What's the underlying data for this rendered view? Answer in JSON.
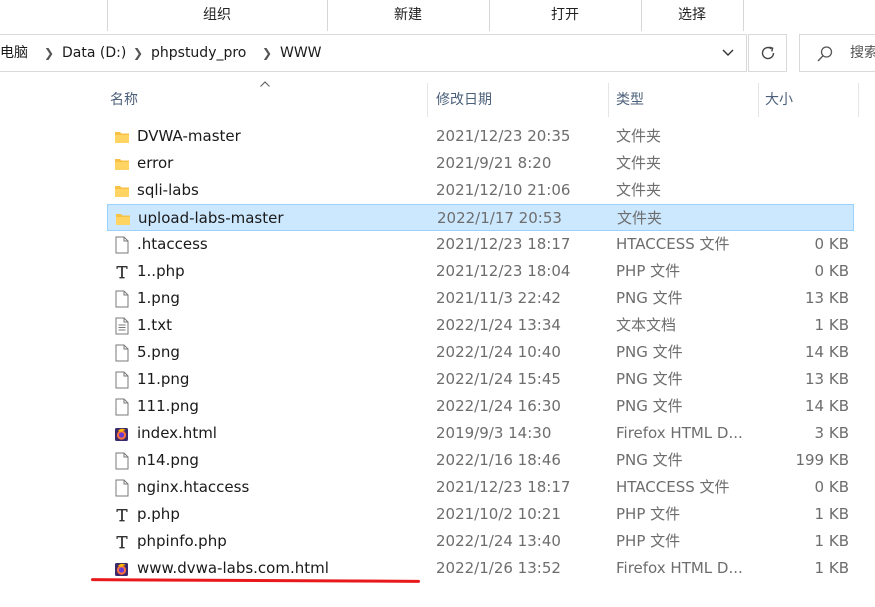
{
  "ribbon": {
    "groups": [
      "组织",
      "新建",
      "打开",
      "选择"
    ]
  },
  "address": {
    "crumbs": [
      "此电脑",
      "Data (D:)",
      "phpstudy_pro",
      "WWW"
    ],
    "search_placeholder": "搜索"
  },
  "columns": {
    "name": "名称",
    "date": "修改日期",
    "type": "类型",
    "size": "大小"
  },
  "files": [
    {
      "name": "DVWA-master",
      "date": "2021/12/23 20:35",
      "type": "文件夹",
      "size": "",
      "icon": "folder-icon"
    },
    {
      "name": "error",
      "date": "2021/9/21 8:20",
      "type": "文件夹",
      "size": "",
      "icon": "folder-icon"
    },
    {
      "name": "sqli-labs",
      "date": "2021/12/10 21:06",
      "type": "文件夹",
      "size": "",
      "icon": "folder-icon"
    },
    {
      "name": "upload-labs-master",
      "date": "2022/1/17 20:53",
      "type": "文件夹",
      "size": "",
      "icon": "folder-icon",
      "selected": true
    },
    {
      "name": ".htaccess",
      "date": "2021/12/23 18:17",
      "type": "HTACCESS 文件",
      "size": "0 KB",
      "icon": "file-icon"
    },
    {
      "name": "1..php",
      "date": "2021/12/23 18:04",
      "type": "PHP 文件",
      "size": "0 KB",
      "icon": "php-file-icon"
    },
    {
      "name": "1.png",
      "date": "2021/11/3 22:42",
      "type": "PNG 文件",
      "size": "13 KB",
      "icon": "file-icon"
    },
    {
      "name": "1.txt",
      "date": "2022/1/24 13:34",
      "type": "文本文档",
      "size": "1 KB",
      "icon": "text-file-icon"
    },
    {
      "name": "5.png",
      "date": "2022/1/24 10:40",
      "type": "PNG 文件",
      "size": "14 KB",
      "icon": "file-icon"
    },
    {
      "name": "11.png",
      "date": "2022/1/24 15:45",
      "type": "PNG 文件",
      "size": "13 KB",
      "icon": "file-icon"
    },
    {
      "name": "111.png",
      "date": "2022/1/24 16:30",
      "type": "PNG 文件",
      "size": "14 KB",
      "icon": "file-icon"
    },
    {
      "name": "index.html",
      "date": "2019/9/3 14:30",
      "type": "Firefox HTML D...",
      "size": "3 KB",
      "icon": "firefox-html-icon"
    },
    {
      "name": "n14.png",
      "date": "2022/1/16 18:46",
      "type": "PNG 文件",
      "size": "199 KB",
      "icon": "file-icon"
    },
    {
      "name": "nginx.htaccess",
      "date": "2021/12/23 18:17",
      "type": "HTACCESS 文件",
      "size": "0 KB",
      "icon": "file-icon"
    },
    {
      "name": "p.php",
      "date": "2021/10/2 10:21",
      "type": "PHP 文件",
      "size": "1 KB",
      "icon": "php-file-icon"
    },
    {
      "name": "phpinfo.php",
      "date": "2022/1/24 13:40",
      "type": "PHP 文件",
      "size": "1 KB",
      "icon": "php-file-icon"
    },
    {
      "name": "www.dvwa-labs.com.html",
      "date": "2022/1/26 13:52",
      "type": "Firefox HTML D...",
      "size": "1 KB",
      "icon": "firefox-html-icon"
    }
  ],
  "colors": {
    "folder": "#f6c144",
    "selection_bg": "#cce8ff",
    "selection_border": "#99d1ff",
    "annotation": "#e8191c"
  }
}
